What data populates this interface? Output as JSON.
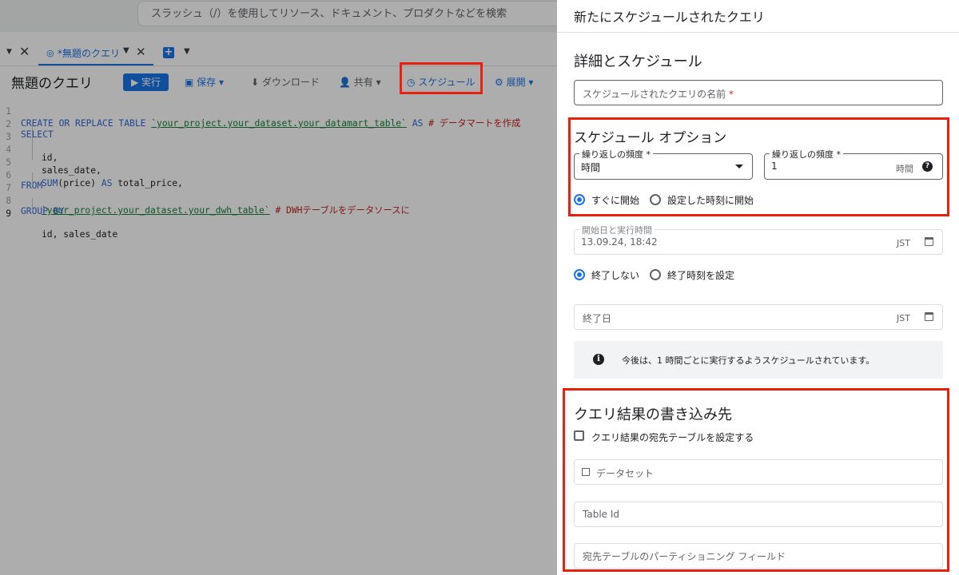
{
  "search": {
    "placeholder": "スラッシュ（/）を使用してリソース、ドキュメント、プロダクトなどを検索"
  },
  "tabs": {
    "active_label": "*無題のクエリ"
  },
  "toolbar": {
    "query_title": "無題のクエリ",
    "run_label": "実行",
    "save_label": "保存",
    "download_label": "ダウンロード",
    "share_label": "共有",
    "schedule_label": "スケジュール",
    "deploy_label": "展開"
  },
  "editor": {
    "line_numbers": [
      "1",
      "2",
      "3",
      "4",
      "5",
      "6",
      "7",
      "8",
      "9"
    ],
    "l1_kw": "CREATE OR REPLACE TABLE ",
    "l1_table": "`your_project.your_dataset.your_datamart_table`",
    "l1_as": " AS ",
    "l1_comment": "# データマートを作成",
    "l2": "SELECT",
    "l3": "id,",
    "l4": "sales_date,",
    "l5_fn": "SUM",
    "l5_rest": "(price) ",
    "l5_as": "AS",
    "l5_tail": " total_price,",
    "l6": "FROM",
    "l7_table": "`your_project.your_dataset.your_dwh_table`",
    "l7_comment": " # DWHテーブルをデータソースに",
    "l8": "GROUP BY",
    "l9": "id, sales_date"
  },
  "panel": {
    "title": "新たにスケジュールされたクエリ",
    "details_heading": "詳細とスケジュール",
    "name_placeholder": "スケジュールされたクエリの名前",
    "required_mark": "*",
    "schedule_options_heading": "スケジュール オプション",
    "repeat_label_1": "繰り返しの頻度",
    "repeat_value_1": "時間",
    "repeat_label_2": "繰り返しの頻度",
    "repeat_value_2": "1",
    "repeat_unit": "時間",
    "start_now": "すぐに開始",
    "start_at_time": "設定した時刻に開始",
    "start_date_label": "開始日と実行時間",
    "start_date_value": "13.09.24, 18:42",
    "timezone": "JST",
    "no_end": "終了しない",
    "set_end": "終了時刻を設定",
    "end_date_placeholder": "終了日",
    "end_timezone": "JST",
    "info_text": "今後は、1 時間ごとに実行するようスケジュールされています。",
    "destination_heading": "クエリ結果の書き込み先",
    "destination_checkbox_label": "クエリ結果の宛先テーブルを設定する",
    "dataset_placeholder": "データセット",
    "table_id_placeholder": "Table Id",
    "partition_placeholder": "宛先テーブルのパーティショニング フィールド"
  },
  "colors": {
    "highlight": "#e8200f",
    "accent": "#1a73e8"
  }
}
